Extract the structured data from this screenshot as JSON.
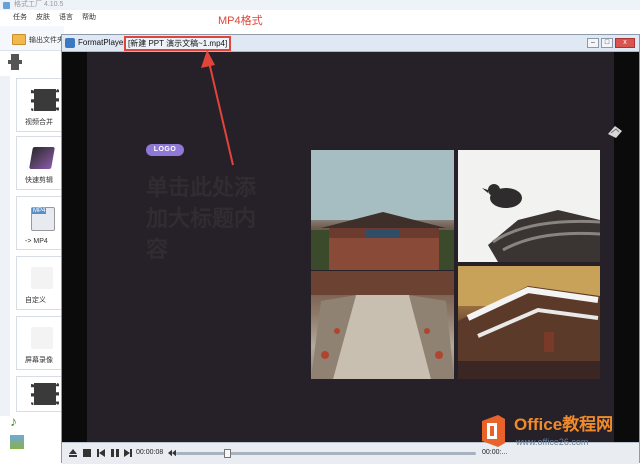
{
  "app": {
    "title": "格式工厂 4.10.5",
    "menu": [
      "任务",
      "皮肤",
      "语言",
      "帮助"
    ],
    "toolbar_button": "输出文件夹"
  },
  "sidebar": {
    "items": [
      {
        "label": "视频合并",
        "icon": "video-merge-icon",
        "color": "#3a3a3a"
      },
      {
        "label": "快速剪辑",
        "icon": "quick-cut-icon",
        "color": "#7a5a9a"
      },
      {
        "label": "-> MP4",
        "icon": "mp4-icon",
        "color": "#5b8ec9",
        "badge": "MP4"
      },
      {
        "label": "自定义",
        "icon": "custom-icon",
        "color": "#f3f3f3"
      },
      {
        "label": "屏幕录像",
        "icon": "screen-record-icon",
        "color": "#f3f3f3"
      }
    ]
  },
  "player": {
    "app_name": "FormatPlayer",
    "file_name": "[新建 PPT 演示文稿~1.mp4]",
    "window_buttons": {
      "minimize": "–",
      "maximize": "□",
      "close": "x"
    },
    "slide": {
      "logo_text": "LOGO",
      "title": "单击此处添加大标题内容"
    },
    "controls": {
      "time_current": "00:00:08",
      "time_end": "00:00:...",
      "progress_fraction": 0.17
    }
  },
  "annotation": {
    "label": "MP4格式",
    "color": "#e0443a"
  },
  "watermark": {
    "title_latin": "Office",
    "title_cn": "教程网",
    "url": "www.office26.com",
    "color": "#f08a2a"
  }
}
